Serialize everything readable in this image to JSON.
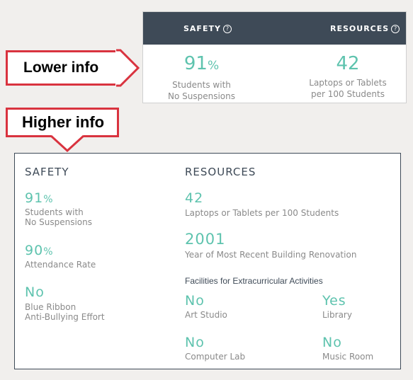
{
  "callouts": {
    "lower": "Lower info",
    "higher": "Higher info"
  },
  "compact_card": {
    "header": {
      "safety": "SAFETY",
      "resources": "RESOURCES",
      "help_icon": "?"
    },
    "safety": {
      "value": "91",
      "unit": "%",
      "desc_line1": "Students with",
      "desc_line2": "No Suspensions"
    },
    "resources": {
      "value": "42",
      "desc_line1": "Laptops or Tablets",
      "desc_line2": "per 100 Students"
    }
  },
  "detail_card": {
    "safety": {
      "heading": "SAFETY",
      "items": [
        {
          "value": "91",
          "unit": "%",
          "desc_line1": "Students with",
          "desc_line2": "No Suspensions"
        },
        {
          "value": "90",
          "unit": "%",
          "desc_line1": "Attendance Rate"
        },
        {
          "value": "No",
          "desc_line1": "Blue Ribbon",
          "desc_line2": "Anti-Bullying Effort"
        }
      ]
    },
    "resources": {
      "heading": "RESOURCES",
      "laptops": {
        "value": "42",
        "desc": "Laptops or Tablets per 100 Students"
      },
      "renovation": {
        "value": "2001",
        "desc": "Year of Most Recent Building Renovation"
      },
      "facilities_heading": "Facilities for Extracurricular Activities",
      "facilities": [
        {
          "value": "No",
          "label": "Art Studio"
        },
        {
          "value": "Yes",
          "label": "Library"
        },
        {
          "value": "No",
          "label": "Computer Lab"
        },
        {
          "value": "No",
          "label": "Music Room"
        }
      ]
    }
  },
  "colors": {
    "accent": "#5ec3ae",
    "header_bg": "#3e4a57",
    "callout_border": "#d9333f",
    "muted_text": "#8a8a8a"
  }
}
